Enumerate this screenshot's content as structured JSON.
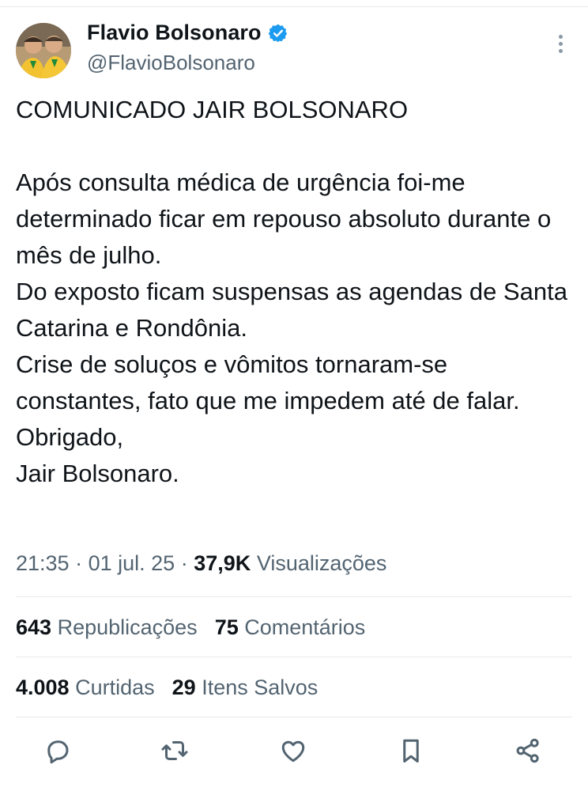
{
  "author": {
    "name": "Flavio Bolsonaro",
    "handle": "@FlavioBolsonaro",
    "verified": true
  },
  "tweet": {
    "text": "COMUNICADO JAIR BOLSONARO\n\nApós consulta médica de urgência foi-me determinado ficar em repouso absoluto durante o mês de julho.\nDo exposto ficam suspensas as agendas de Santa Catarina e Rondônia.\nCrise de soluços e vômitos tornaram-se constantes, fato que me impedem até de falar.\nObrigado,\nJair Bolsonaro."
  },
  "meta": {
    "time": "21:35",
    "date": "01 jul. 25",
    "views_count": "37,9K",
    "views_label": "Visualizações",
    "separator": "·"
  },
  "stats": {
    "reposts_count": "643",
    "reposts_label": "Republicações",
    "comments_count": "75",
    "comments_label": "Comentários",
    "likes_count": "4.008",
    "likes_label": "Curtidas",
    "saves_count": "29",
    "saves_label": "Itens Salvos"
  },
  "actions": [
    "reply-icon",
    "repost-icon",
    "like-icon",
    "bookmark-icon",
    "share-icon"
  ],
  "colors": {
    "text": "#0f1419",
    "secondary": "#536471",
    "verified_blue": "#1d9bf0",
    "divider": "#e7e9ea"
  }
}
